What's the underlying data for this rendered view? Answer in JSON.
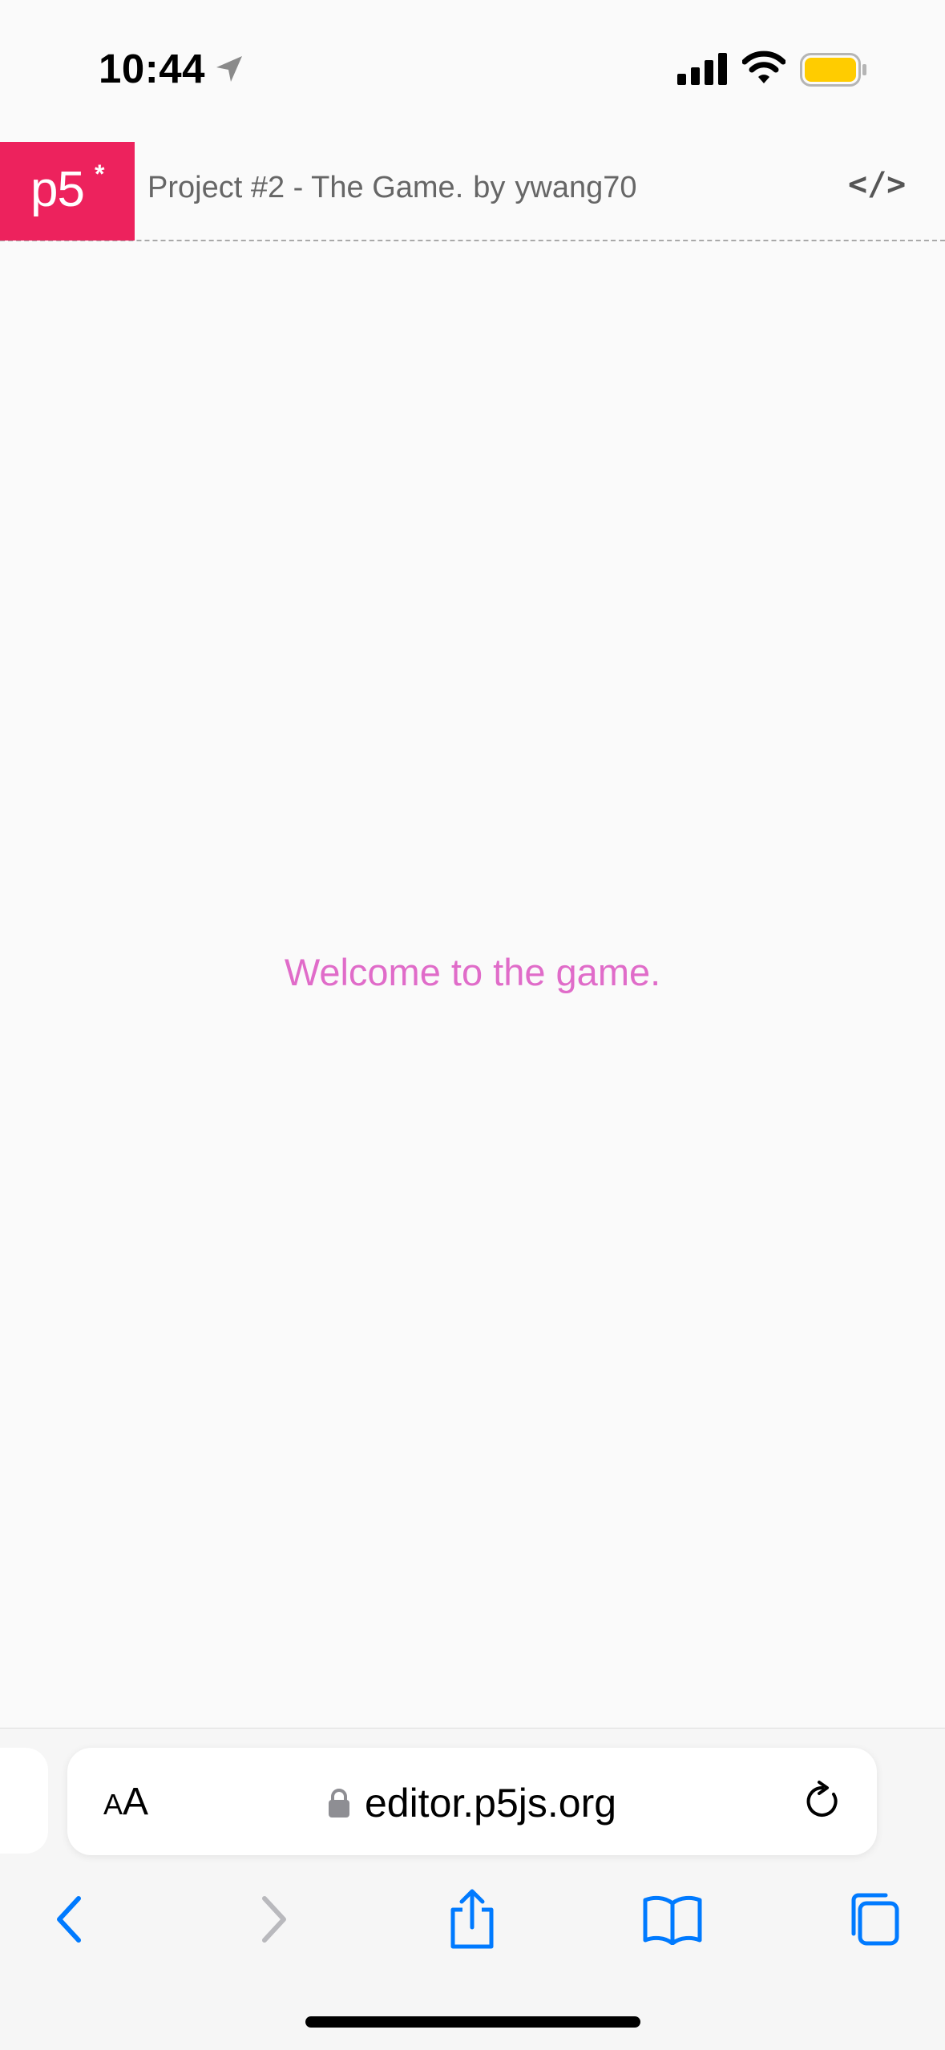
{
  "status_bar": {
    "time": "10:44",
    "icons": [
      "location-arrow-icon",
      "cellular-signal-icon",
      "wifi-icon",
      "battery-icon"
    ],
    "battery_color": "#ffcc00"
  },
  "p5_header": {
    "logo_text": "p5",
    "logo_star": "*",
    "logo_color": "#ed225d",
    "project_title": "Project #2 - The Game.",
    "by_label": "by",
    "author": "ywang70",
    "code_toggle_label": "</>"
  },
  "canvas": {
    "message": "Welcome to the game.",
    "message_color": "#e06cc9"
  },
  "safari": {
    "aa_small": "A",
    "aa_large": "A",
    "url": "editor.p5js.org",
    "toolbar_icons": [
      "back-icon",
      "forward-icon",
      "share-icon",
      "bookmarks-icon",
      "tabs-icon"
    ],
    "accent_color": "#007aff"
  }
}
